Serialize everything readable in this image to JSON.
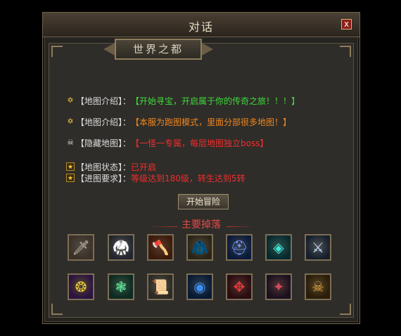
{
  "dialog": {
    "title": "对话",
    "close_label": "x",
    "map_name": "世界之都",
    "rows": [
      {
        "key": "row-intro-1",
        "icon": "six-point-star-icon",
        "label": "【地图介绍】：",
        "value": "【开始寻宝，开启属于你的传奇之旅！！！】",
        "label_color": "#dcdcdc",
        "value_color": "#3ddc3d"
      },
      {
        "key": "row-intro-2",
        "icon": "six-point-star-icon",
        "label": "【地图介绍】：",
        "value": "【本服为跑图模式，里面分部很多地图！】",
        "label_color": "#dcdcdc",
        "value_color": "#f0861f"
      },
      {
        "key": "row-hidden",
        "icon": "skull-icon",
        "label": "【隐藏地图】：",
        "value": "【一怪一专属，每层地图独立boss】",
        "label_color": "#dcdcdc",
        "value_color": "#ef2e2e"
      },
      {
        "key": "row-status",
        "icon": "star-badge-icon",
        "label": "【地图状态】：",
        "value": "已开启",
        "label_color": "#dcdcdc",
        "value_color": "#ef2e2e"
      },
      {
        "key": "row-requirement",
        "icon": "star-badge-icon",
        "label": "【进图要求】：",
        "value": "等级达到180级，转生达到5转",
        "label_color": "#dcdcdc",
        "value_color": "#ef2e2e"
      }
    ],
    "start_button": "开始冒险",
    "drops_title": "主要掉落",
    "drops": [
      {
        "icon": "dagger-icon",
        "glyph": "🗡",
        "bg": "#3b3128",
        "color": "#d7c8b4"
      },
      {
        "icon": "white-armor-icon",
        "glyph": "🥋",
        "bg": "#22262e",
        "color": "#e4e8ee"
      },
      {
        "icon": "fire-axe-icon",
        "glyph": "🪓",
        "bg": "#3b1a0c",
        "color": "#ff7a2a"
      },
      {
        "icon": "golden-armor-icon",
        "glyph": "🧥",
        "bg": "#2a2418",
        "color": "#e8c88a"
      },
      {
        "icon": "dark-helmet-icon",
        "glyph": "⛑",
        "bg": "#0b1a3a",
        "color": "#6f9cff"
      },
      {
        "icon": "cyan-shield-icon",
        "glyph": "◈",
        "bg": "#062a2f",
        "color": "#43e6d6"
      },
      {
        "icon": "blade-icon",
        "glyph": "⚔",
        "bg": "#16202c",
        "color": "#c8e2ff"
      },
      {
        "icon": "gold-medallion-icon",
        "glyph": "❂",
        "bg": "#2c1240",
        "color": "#e6c83c"
      },
      {
        "icon": "green-orb-icon",
        "glyph": "❃",
        "bg": "#0c2a22",
        "color": "#5ee49a"
      },
      {
        "icon": "scroll-icon",
        "glyph": "📜",
        "bg": "#2c2a24",
        "color": "#e6dec8"
      },
      {
        "icon": "blue-ring-icon",
        "glyph": "◉",
        "bg": "#081a33",
        "color": "#3a8ef0"
      },
      {
        "icon": "red-gauntlet-icon",
        "glyph": "✥",
        "bg": "#2a0c10",
        "color": "#e33a3a"
      },
      {
        "icon": "dark-claw-icon",
        "glyph": "✦",
        "bg": "#1a1020",
        "color": "#d04a5a"
      },
      {
        "icon": "gold-skull-icon",
        "glyph": "☠",
        "bg": "#2a1c08",
        "color": "#e9a83a"
      }
    ]
  }
}
